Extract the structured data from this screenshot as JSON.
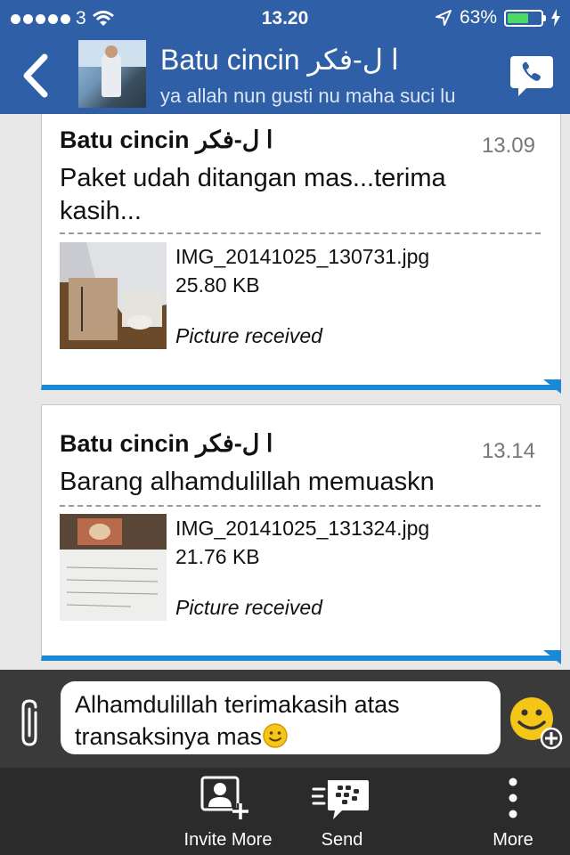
{
  "status_bar": {
    "carrier": "3",
    "time": "13.20",
    "battery_percent": "63%",
    "battery_level": 0.63
  },
  "header": {
    "contact_name": "Batu cincin ا ل-فكر",
    "contact_status": "ya allah nun gusti nu maha suci lu"
  },
  "messages": [
    {
      "sender": "Batu cincin ا ل-فكر",
      "time": "13.09",
      "text": "Paket udah ditangan mas...terima kasih...",
      "file_name": "IMG_20141025_130731.jpg",
      "file_size": "25.80 KB",
      "file_status": "Picture received"
    },
    {
      "sender": "Batu cincin ا ل-فكر",
      "time": "13.14",
      "text": "Barang alhamdulillah memuaskn",
      "file_name": "IMG_20141025_131324.jpg",
      "file_size": "21.76 KB",
      "file_status": "Picture received"
    }
  ],
  "compose": {
    "value": "Alhamdulillah terimakasih atas transaksinya mas"
  },
  "tabbar": {
    "invite_label": "Invite More",
    "send_label": "Send",
    "more_label": "More"
  },
  "colors": {
    "header_bg": "#2f5fa6",
    "bubble_accent": "#1b8ad6",
    "battery": "#4cd964"
  }
}
